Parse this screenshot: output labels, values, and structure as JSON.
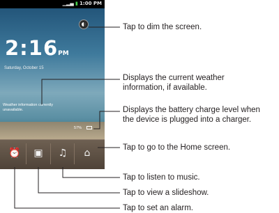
{
  "phone": {
    "status_time": "1:00 PM",
    "clock_time": "2:16",
    "clock_ampm": "PM",
    "date": "Saturday, October 15",
    "weather_text": "Weather information currently unavailable.",
    "battery_text": "57%"
  },
  "callouts": {
    "dim": "Tap to dim the screen.",
    "weather_line1": "Displays the current weather",
    "weather_line2": "information, if available.",
    "battery_line1": "Displays the battery charge level when",
    "battery_line2": "the device is plugged into a charger.",
    "home": "Tap to go to the Home screen.",
    "music": "Tap to listen to music.",
    "slideshow": "Tap to view a slideshow.",
    "alarm": "Tap to set an alarm."
  },
  "icons": {
    "dim": "dim-screen-icon",
    "alarm": "alarm-clock-icon",
    "slideshow": "slideshow-icon",
    "music": "music-note-icon",
    "home": "home-icon",
    "battery": "battery-icon",
    "signal": "signal-icon"
  }
}
